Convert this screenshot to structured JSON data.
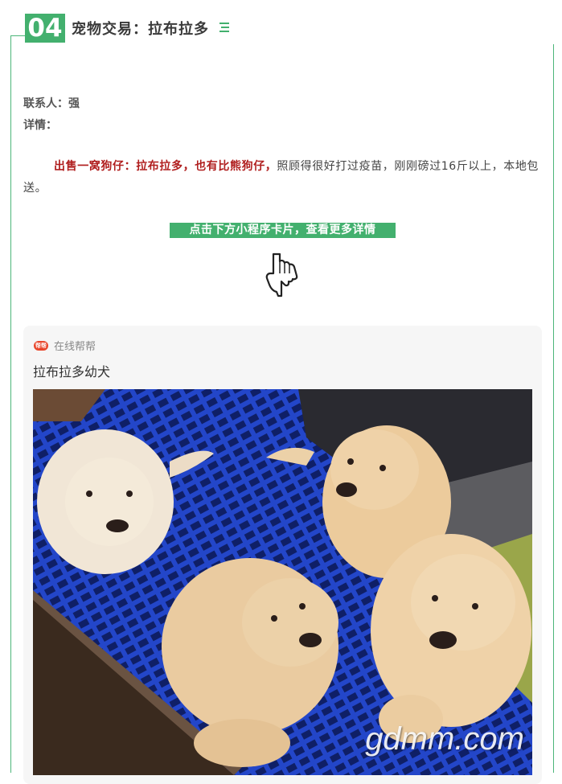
{
  "section": {
    "number": "04",
    "title": "宠物交易：拉布拉多"
  },
  "contact": {
    "label_line": "联系人：强",
    "details_label": "详情："
  },
  "description": {
    "highlight": "出售一窝狗仔：拉布拉多，也有比熊狗仔，",
    "rest": "照顾得很好打过疫苗，刚刚磅过16斤以上，本地包送。"
  },
  "cta": {
    "text": "点击下方小程序卡片，查看更多详情"
  },
  "card": {
    "source_name": "在线帮帮",
    "logo_text": "帮帮",
    "title": "拉布拉多幼犬",
    "watermark": "gdmm.com"
  },
  "colors": {
    "accent": "#43b06e",
    "highlight_red": "#b01e1e"
  },
  "icons": {
    "menu": "menu-lines-icon",
    "pointer": "pointing-down-hand-icon"
  }
}
